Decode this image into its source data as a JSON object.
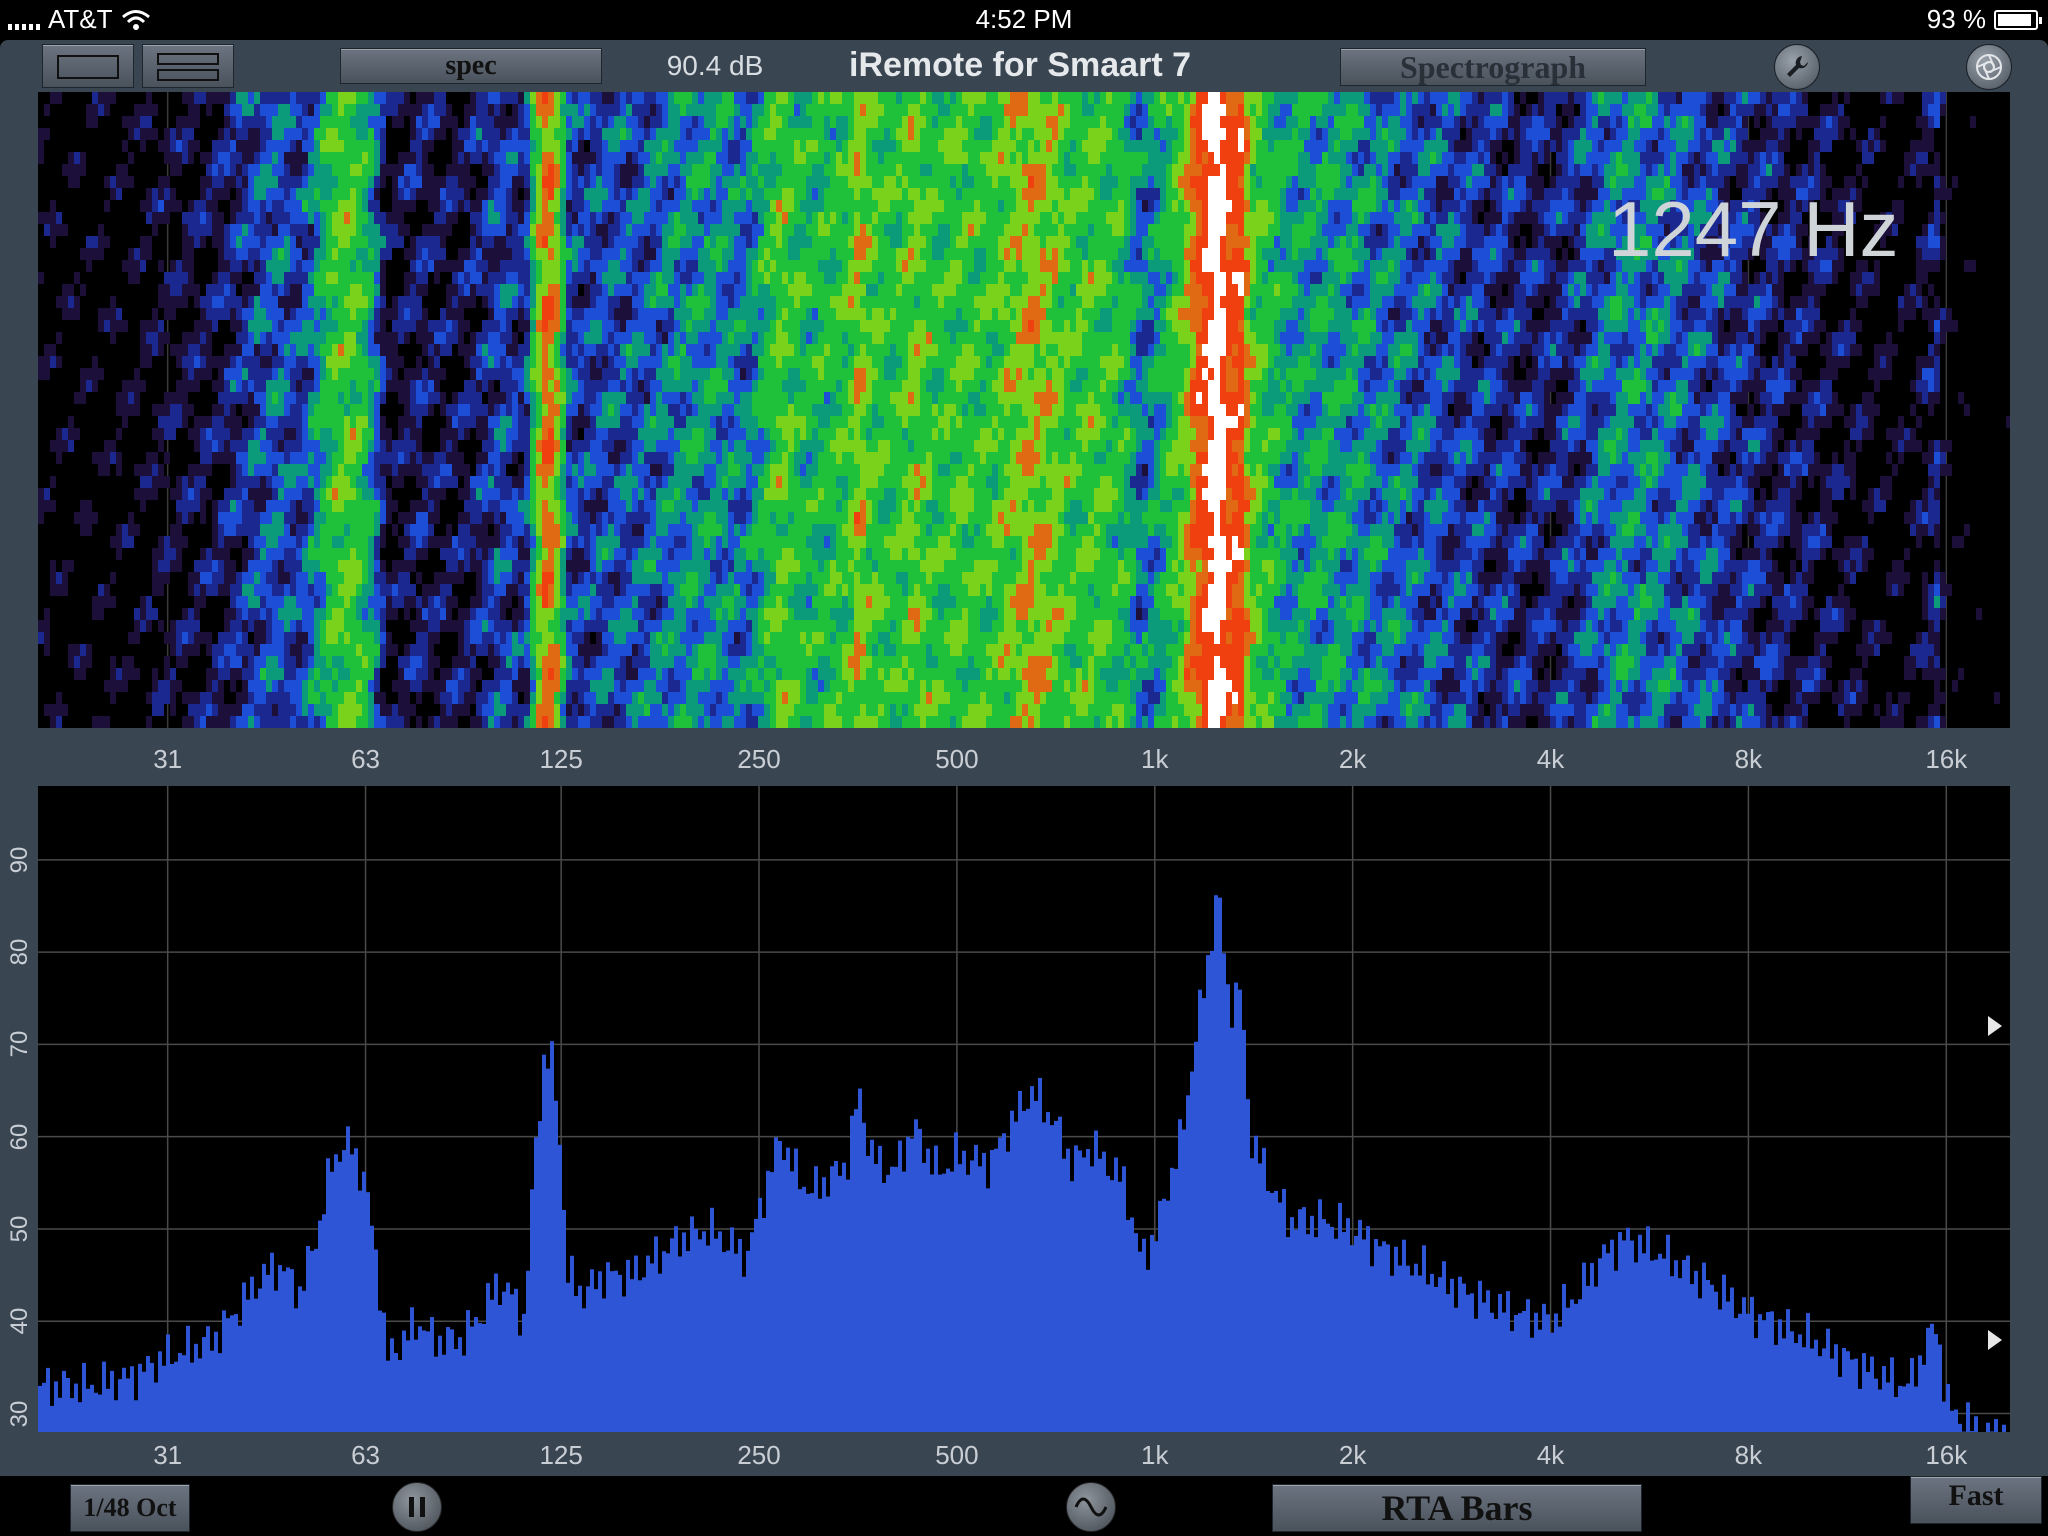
{
  "statusbar": {
    "carrier": "AT&T",
    "time": "4:52 PM",
    "battery": "93 %",
    "battery_level": 0.93
  },
  "toolbar": {
    "title": "iRemote for Smaart 7",
    "spec_label": "spec",
    "level": "90.4 dB",
    "view_label": "Spectrograph",
    "icons": [
      "single-layout-icon",
      "split-layout-icon",
      "wrench-icon",
      "aperture-icon"
    ]
  },
  "spectrograph": {
    "frequency_readout": "1247 Hz"
  },
  "freq_ticks": [
    "31",
    "63",
    "125",
    "250",
    "500",
    "1k",
    "2k",
    "4k",
    "8k",
    "16k"
  ],
  "db_ticks": [
    "90",
    "80",
    "70",
    "60",
    "50",
    "40",
    "30"
  ],
  "bottombar": {
    "resolution_label": "1/48 Oct",
    "mode_label": "RTA Bars",
    "speed_label": "Fast",
    "icons": [
      "pause-icon",
      "signal-generator-icon"
    ]
  },
  "colors": {
    "bar_fill": "#2d55d6",
    "grid": "#4a4a4a",
    "panel": "#3a4552"
  },
  "chart_data": {
    "type": "bar",
    "title": "",
    "xlabel": "",
    "ylabel": "",
    "x_scale": "log2",
    "xlim": [
      20,
      20000
    ],
    "ylim": [
      28,
      98
    ],
    "grid": true,
    "series": [
      {
        "name": "",
        "points": [
          [
            20,
            33
          ],
          [
            24,
            33
          ],
          [
            28,
            34
          ],
          [
            31,
            36
          ],
          [
            34,
            37
          ],
          [
            37,
            38
          ],
          [
            40,
            41
          ],
          [
            44,
            45
          ],
          [
            47,
            46
          ],
          [
            50,
            43
          ],
          [
            53,
            49
          ],
          [
            56,
            57
          ],
          [
            58,
            59
          ],
          [
            60,
            59
          ],
          [
            63,
            55
          ],
          [
            66,
            45
          ],
          [
            68,
            36
          ],
          [
            72,
            38
          ],
          [
            76,
            40
          ],
          [
            80,
            38
          ],
          [
            88,
            38
          ],
          [
            95,
            41
          ],
          [
            100,
            44
          ],
          [
            105,
            43
          ],
          [
            110,
            40
          ],
          [
            114,
            58
          ],
          [
            118,
            69
          ],
          [
            121,
            68
          ],
          [
            124,
            62
          ],
          [
            128,
            45
          ],
          [
            135,
            43
          ],
          [
            145,
            45
          ],
          [
            160,
            45
          ],
          [
            175,
            47
          ],
          [
            190,
            49
          ],
          [
            210,
            50
          ],
          [
            240,
            47
          ],
          [
            250,
            52
          ],
          [
            270,
            60
          ],
          [
            285,
            56
          ],
          [
            300,
            54
          ],
          [
            340,
            57
          ],
          [
            355,
            65
          ],
          [
            370,
            58
          ],
          [
            400,
            56
          ],
          [
            430,
            61
          ],
          [
            470,
            56
          ],
          [
            500,
            58
          ],
          [
            560,
            57
          ],
          [
            600,
            61
          ],
          [
            650,
            65
          ],
          [
            700,
            62
          ],
          [
            750,
            57
          ],
          [
            800,
            59
          ],
          [
            900,
            55
          ],
          [
            950,
            47
          ],
          [
            1000,
            49
          ],
          [
            1050,
            55
          ],
          [
            1100,
            60
          ],
          [
            1150,
            70
          ],
          [
            1200,
            78
          ],
          [
            1247,
            87
          ],
          [
            1300,
            74
          ],
          [
            1350,
            76
          ],
          [
            1400,
            60
          ],
          [
            1500,
            55
          ],
          [
            1600,
            51
          ],
          [
            1800,
            51
          ],
          [
            2000,
            50
          ],
          [
            2200,
            48
          ],
          [
            2500,
            46
          ],
          [
            3000,
            43
          ],
          [
            3500,
            41
          ],
          [
            4000,
            40
          ],
          [
            4400,
            43
          ],
          [
            4800,
            47
          ],
          [
            5200,
            49
          ],
          [
            5600,
            48
          ],
          [
            6000,
            47
          ],
          [
            7000,
            44
          ],
          [
            8000,
            41
          ],
          [
            10000,
            38
          ],
          [
            12000,
            35
          ],
          [
            14000,
            33
          ],
          [
            15500,
            40
          ],
          [
            16000,
            31
          ],
          [
            18000,
            28
          ]
        ]
      }
    ],
    "markers_db": [
      72,
      38
    ]
  }
}
